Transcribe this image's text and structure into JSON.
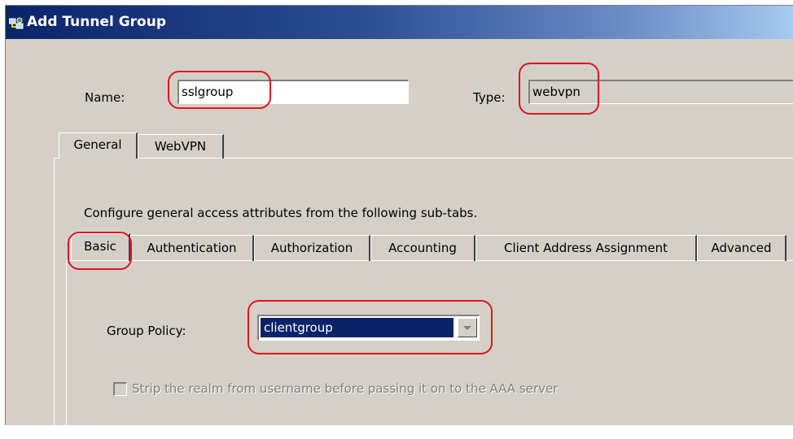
{
  "window": {
    "title": "Add Tunnel Group",
    "icon": "network-tunnel-icon"
  },
  "fields": {
    "name_label": "Name:",
    "name_value": "sslgroup",
    "type_label": "Type:",
    "type_value": "webvpn"
  },
  "outer_tabs": [
    {
      "label": "General",
      "selected": true
    },
    {
      "label": "WebVPN",
      "selected": false
    }
  ],
  "general": {
    "description": "Configure general access attributes from the following sub-tabs."
  },
  "inner_tabs": [
    {
      "label": "Basic",
      "selected": true
    },
    {
      "label": "Authentication",
      "selected": false
    },
    {
      "label": "Authorization",
      "selected": false
    },
    {
      "label": "Accounting",
      "selected": false
    },
    {
      "label": "Client Address Assignment",
      "selected": false
    },
    {
      "label": "Advanced",
      "selected": false
    }
  ],
  "basic": {
    "group_policy_label": "Group Policy:",
    "group_policy_value": "clientgroup",
    "strip_realm_label": "Strip the realm from username before passing it on to the AAA server",
    "strip_realm_checked": false,
    "strip_realm_enabled": false
  },
  "colors": {
    "highlight": "#e0141e",
    "titlebar": "#0a246a",
    "dialog_bg": "#d4d0c8",
    "selection": "#0a246a"
  }
}
